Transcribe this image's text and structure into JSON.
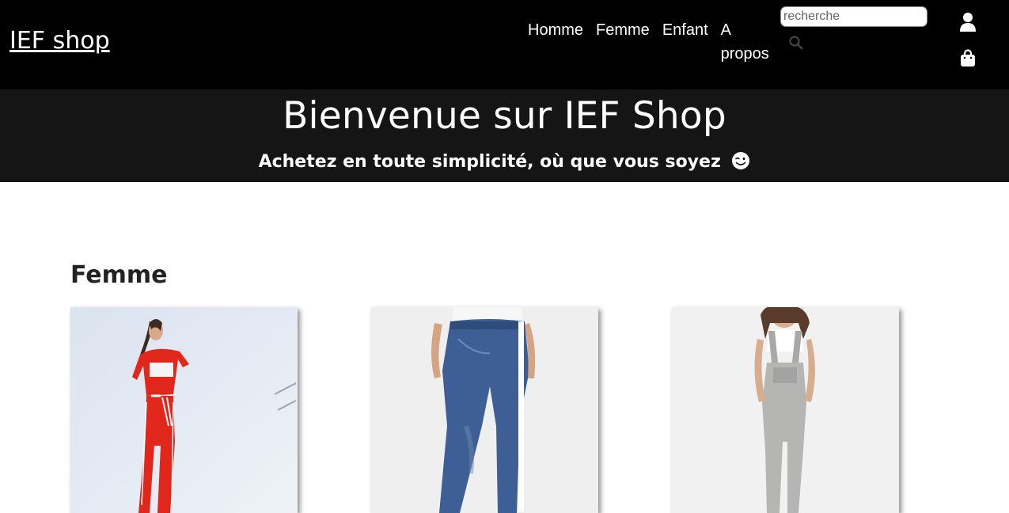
{
  "header": {
    "brand": "IEF shop",
    "nav": [
      "Homme",
      "Femme",
      "Enfant",
      "A propos"
    ],
    "search_placeholder": "recherche",
    "icons": {
      "search": "search-icon",
      "user": "user-icon",
      "bag": "shopping-bag-icon"
    }
  },
  "hero": {
    "title": "Bienvenue sur IEF Shop",
    "subtitle": "Achetez en toute simplicité, où que vous soyez",
    "emoji": "winking-face-emoji"
  },
  "section": {
    "title": "Femme",
    "products": [
      {
        "image": "woman-red-tracksuit-photo"
      },
      {
        "image": "woman-blue-jeans-photo"
      },
      {
        "image": "woman-grey-overalls-photo"
      }
    ]
  },
  "colors": {
    "header_bg": "#000000",
    "hero_bg": "#151515",
    "text": "#ffffff"
  }
}
